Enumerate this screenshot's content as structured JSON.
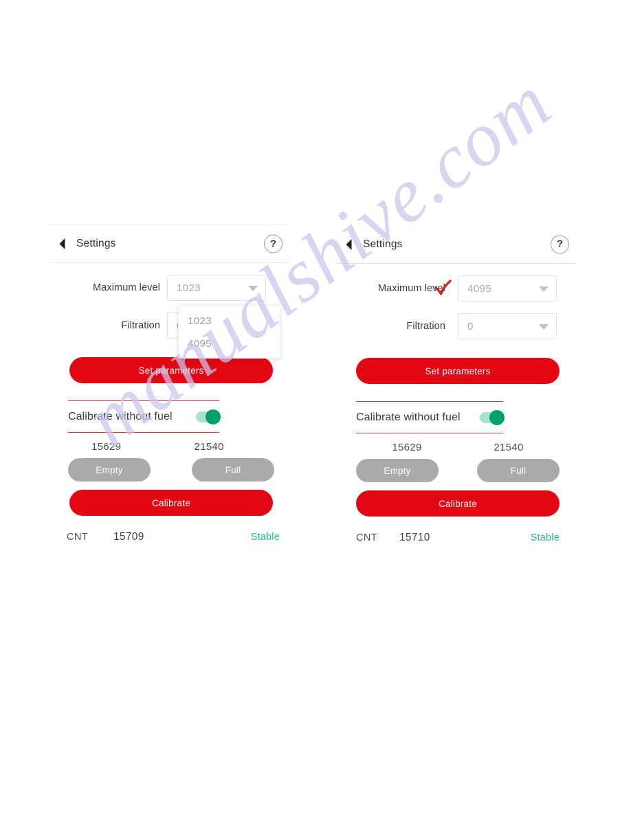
{
  "watermark": {
    "text": "manualshive.com"
  },
  "panels": [
    {
      "id": "left",
      "header": {
        "title": "Settings",
        "back_icon": "back-triangle-icon",
        "help_icon": "question-mark-icon",
        "help_label": "?"
      },
      "fields": [
        {
          "label": "Maximum level",
          "value": "1023"
        },
        {
          "label": "Filtration",
          "value": "0"
        }
      ],
      "dropdown": {
        "open": true,
        "options": [
          "1023",
          "4095"
        ]
      },
      "set_parameters_label": "Set parameters",
      "toggle": {
        "label": "Calibrate without fuel",
        "state": "on",
        "color": "#00a06a"
      },
      "counters": {
        "empty_value": "15629",
        "full_value": "21540"
      },
      "empty_label": "Empty",
      "full_label": "Full",
      "calibrate_label": "Calibrate",
      "status": {
        "label": "CNT",
        "value": "15709",
        "state": "Stable",
        "state_color": "#1fbf8f"
      }
    },
    {
      "id": "right",
      "header": {
        "title": "Settings",
        "back_icon": "back-triangle-icon",
        "help_icon": "question-mark-icon",
        "help_label": "?"
      },
      "fields": [
        {
          "label": "Maximum level",
          "value": "4095"
        },
        {
          "label": "Filtration",
          "value": "0"
        }
      ],
      "annotation": {
        "type": "red-checkmark",
        "target": "Maximum level",
        "color": "#d32020"
      },
      "set_parameters_label": "Set parameters",
      "toggle": {
        "label": "Calibrate without fuel",
        "state": "on",
        "color": "#00a06a"
      },
      "counters": {
        "empty_value": "15629",
        "full_value": "21540"
      },
      "empty_label": "Empty",
      "full_label": "Full",
      "calibrate_label": "Calibrate",
      "status": {
        "label": "CNT",
        "value": "15710",
        "state": "Stable",
        "state_color": "#1fbf8f"
      }
    }
  ],
  "theme": {
    "primary_red": "#e30613",
    "gray_button": "#aaaaaa",
    "toggle_green": "#00a06a",
    "status_green": "#1fbf8f",
    "rule_red": "#c73a3a"
  }
}
